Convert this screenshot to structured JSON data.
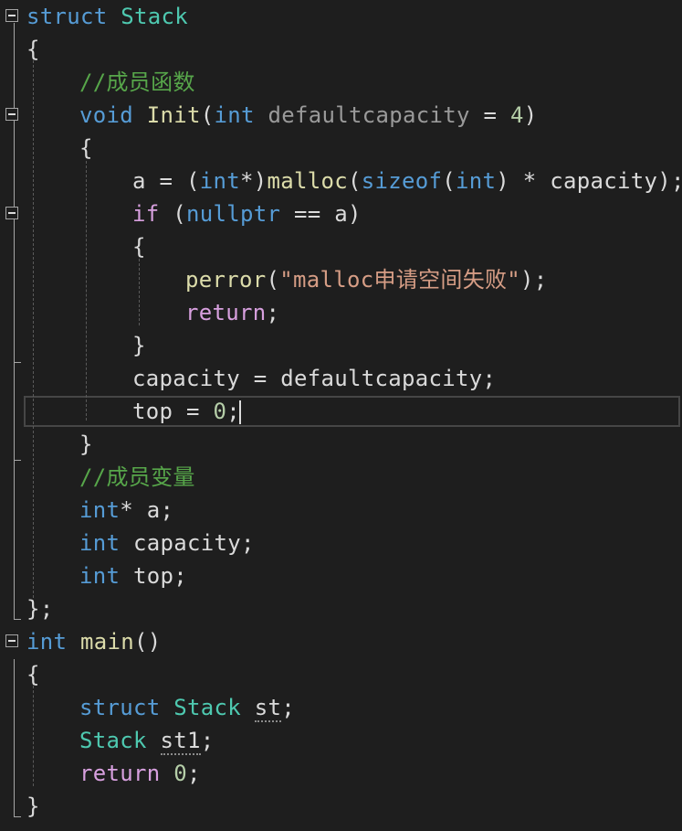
{
  "colors": {
    "background": "#1e1e1e",
    "keyword": "#569cd6",
    "type": "#4ec9b0",
    "function": "#dcdcaa",
    "comment": "#57a64a",
    "string": "#d69d85",
    "control": "#d8a0df",
    "plain": "#dadada",
    "number": "#b5cea8",
    "parameter": "#9a9a9a"
  },
  "icons": {
    "fold": "collapse-minus-icon"
  },
  "code_lines": [
    {
      "fold": true,
      "indent": 0,
      "tokens": [
        [
          "struct",
          "keyword"
        ],
        [
          " ",
          "plain"
        ],
        [
          "Stack",
          "type"
        ]
      ]
    },
    {
      "fold": false,
      "indent": 0,
      "tokens": [
        [
          "{",
          "plain"
        ]
      ]
    },
    {
      "fold": false,
      "indent": 1,
      "tokens": [
        [
          "//成员函数",
          "comment"
        ]
      ]
    },
    {
      "fold": true,
      "indent": 1,
      "tokens": [
        [
          "void",
          "keyword"
        ],
        [
          " ",
          "plain"
        ],
        [
          "Init",
          "function"
        ],
        [
          "(",
          "plain"
        ],
        [
          "int",
          "keyword"
        ],
        [
          " ",
          "plain"
        ],
        [
          "defaultcapacity",
          "parameter"
        ],
        [
          " = ",
          "plain"
        ],
        [
          "4",
          "number"
        ],
        [
          ")",
          "plain"
        ]
      ]
    },
    {
      "fold": false,
      "indent": 1,
      "tokens": [
        [
          "{",
          "plain"
        ]
      ]
    },
    {
      "fold": false,
      "indent": 2,
      "tokens": [
        [
          "a = (",
          "plain"
        ],
        [
          "int",
          "keyword"
        ],
        [
          "*)",
          "plain"
        ],
        [
          "malloc",
          "function"
        ],
        [
          "(",
          "plain"
        ],
        [
          "sizeof",
          "keyword"
        ],
        [
          "(",
          "plain"
        ],
        [
          "int",
          "keyword"
        ],
        [
          ") * capacity);",
          "plain"
        ]
      ]
    },
    {
      "fold": true,
      "indent": 2,
      "tokens": [
        [
          "if",
          "control"
        ],
        [
          " (",
          "plain"
        ],
        [
          "nullptr",
          "keyword"
        ],
        [
          " == a)",
          "plain"
        ]
      ]
    },
    {
      "fold": false,
      "indent": 2,
      "tokens": [
        [
          "{",
          "plain"
        ]
      ]
    },
    {
      "fold": false,
      "indent": 3,
      "tokens": [
        [
          "perror",
          "function"
        ],
        [
          "(",
          "plain"
        ],
        [
          "\"malloc申请空间失败\"",
          "string"
        ],
        [
          ");",
          "plain"
        ]
      ]
    },
    {
      "fold": false,
      "indent": 3,
      "tokens": [
        [
          "return",
          "control"
        ],
        [
          ";",
          "plain"
        ]
      ]
    },
    {
      "fold": false,
      "indent": 2,
      "tokens": [
        [
          "}",
          "plain"
        ]
      ]
    },
    {
      "fold": false,
      "indent": 2,
      "tokens": [
        [
          "capacity = defaultcapacity;",
          "plain"
        ]
      ]
    },
    {
      "fold": false,
      "indent": 2,
      "tokens": [
        [
          "top = ",
          "plain"
        ],
        [
          "0",
          "number"
        ],
        [
          ";",
          "plain"
        ]
      ]
    },
    {
      "fold": false,
      "indent": 1,
      "tokens": [
        [
          "}",
          "plain"
        ]
      ]
    },
    {
      "fold": false,
      "indent": 1,
      "tokens": [
        [
          "//成员变量",
          "comment"
        ]
      ]
    },
    {
      "fold": false,
      "indent": 1,
      "tokens": [
        [
          "int",
          "keyword"
        ],
        [
          "* a;",
          "plain"
        ]
      ]
    },
    {
      "fold": false,
      "indent": 1,
      "tokens": [
        [
          "int",
          "keyword"
        ],
        [
          " capacity;",
          "plain"
        ]
      ]
    },
    {
      "fold": false,
      "indent": 1,
      "tokens": [
        [
          "int",
          "keyword"
        ],
        [
          " top;",
          "plain"
        ]
      ]
    },
    {
      "fold": false,
      "indent": 0,
      "tokens": [
        [
          "};",
          "plain"
        ]
      ]
    },
    {
      "fold": true,
      "indent": 0,
      "tokens": [
        [
          "int",
          "keyword"
        ],
        [
          " ",
          "plain"
        ],
        [
          "main",
          "function"
        ],
        [
          "()",
          "plain"
        ]
      ]
    },
    {
      "fold": false,
      "indent": 0,
      "tokens": [
        [
          "{",
          "plain"
        ]
      ]
    },
    {
      "fold": false,
      "indent": 1,
      "tokens": [
        [
          "struct",
          "keyword"
        ],
        [
          " ",
          "plain"
        ],
        [
          "Stack",
          "type"
        ],
        [
          " ",
          "plain"
        ],
        [
          "st",
          "plain",
          "squiggle"
        ],
        [
          ";",
          "plain"
        ]
      ]
    },
    {
      "fold": false,
      "indent": 1,
      "tokens": [
        [
          "Stack",
          "type"
        ],
        [
          " ",
          "plain"
        ],
        [
          "st1",
          "plain",
          "squiggle"
        ],
        [
          ";",
          "plain"
        ]
      ]
    },
    {
      "fold": false,
      "indent": 1,
      "tokens": [
        [
          "return",
          "control"
        ],
        [
          " ",
          "plain"
        ],
        [
          "0",
          "number"
        ],
        [
          ";",
          "plain"
        ]
      ]
    },
    {
      "fold": false,
      "indent": 0,
      "tokens": [
        [
          "}",
          "plain"
        ]
      ]
    }
  ]
}
